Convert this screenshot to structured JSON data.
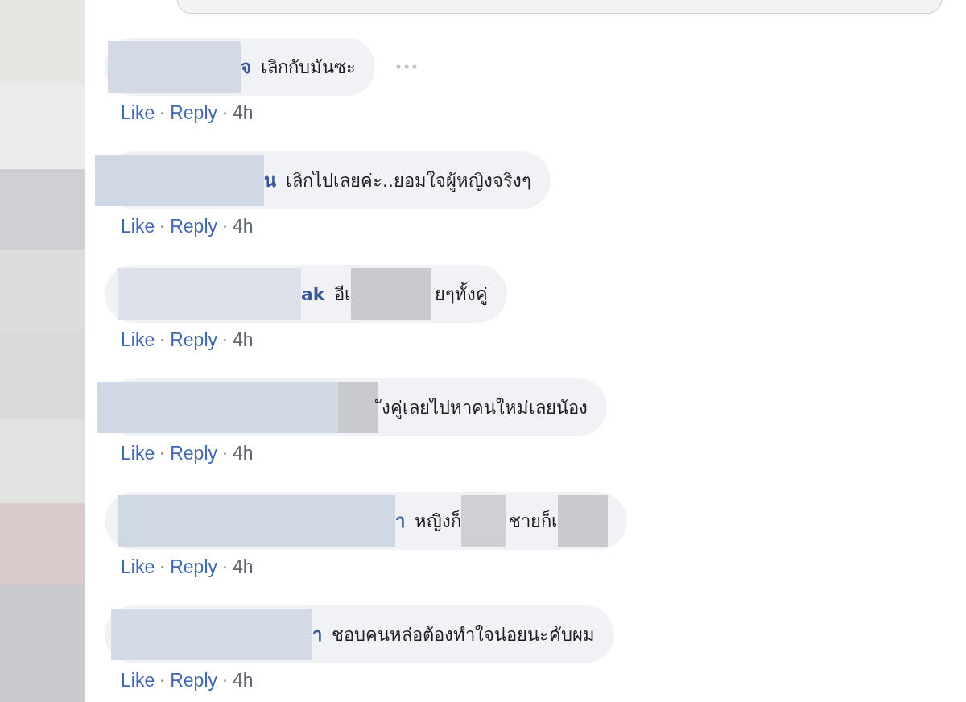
{
  "comments": [
    {
      "menu_visible": true,
      "segments": [
        {
          "kind": "redaction",
          "color": "#d3dae6"
        },
        {
          "kind": "name",
          "text": "จ"
        },
        {
          "kind": "text",
          "text": "เลิกกับมันซะ"
        }
      ],
      "like": "Like",
      "reply": "Reply",
      "time": "4h"
    },
    {
      "menu_visible": false,
      "segments": [
        {
          "kind": "redaction",
          "color": "#d0d8e6"
        },
        {
          "kind": "name",
          "text": "น"
        },
        {
          "kind": "text",
          "text": "เลิกไปเลยค่ะ..ยอมใจผู้หญิงจริงๆ"
        }
      ],
      "like": "Like",
      "reply": "Reply",
      "time": "4h"
    },
    {
      "menu_visible": false,
      "segments": [
        {
          "kind": "redaction",
          "color": "#dde2ea"
        },
        {
          "kind": "name",
          "text": "ak"
        },
        {
          "kind": "text",
          "text": "อีเ"
        },
        {
          "kind": "redaction",
          "color": "#c9cacd"
        },
        {
          "kind": "text",
          "text": "ยๆทั้งคู่"
        }
      ],
      "like": "Like",
      "reply": "Reply",
      "time": "4h"
    },
    {
      "menu_visible": false,
      "segments": [
        {
          "kind": "redaction",
          "color": "#d1d9e6"
        },
        {
          "kind": "redaction",
          "color": "#c9cacd"
        },
        {
          "kind": "text",
          "text": "ังคู่เลยไปหาคนใหม่เลยน้อง"
        }
      ],
      "like": "Like",
      "reply": "Reply",
      "time": "4h"
    },
    {
      "menu_visible": false,
      "segments": [
        {
          "kind": "redaction",
          "color": "#d1d8e5"
        },
        {
          "kind": "name",
          "text": "า"
        },
        {
          "kind": "text",
          "text": "หญิงก็"
        },
        {
          "kind": "redaction",
          "color": "#cfd0d3"
        },
        {
          "kind": "text",
          "text": "ชายก็เ"
        },
        {
          "kind": "redaction",
          "color": "#c9cacd"
        }
      ],
      "like": "Like",
      "reply": "Reply",
      "time": "4h"
    },
    {
      "menu_visible": false,
      "segments": [
        {
          "kind": "redaction",
          "color": "#d4dbe7"
        },
        {
          "kind": "name",
          "text": "า"
        },
        {
          "kind": "text",
          "text": "ชอบคนหล่อต้องทำใจน่อยนะคับผม"
        }
      ],
      "like": "Like",
      "reply": "Reply",
      "time": "4h"
    }
  ]
}
